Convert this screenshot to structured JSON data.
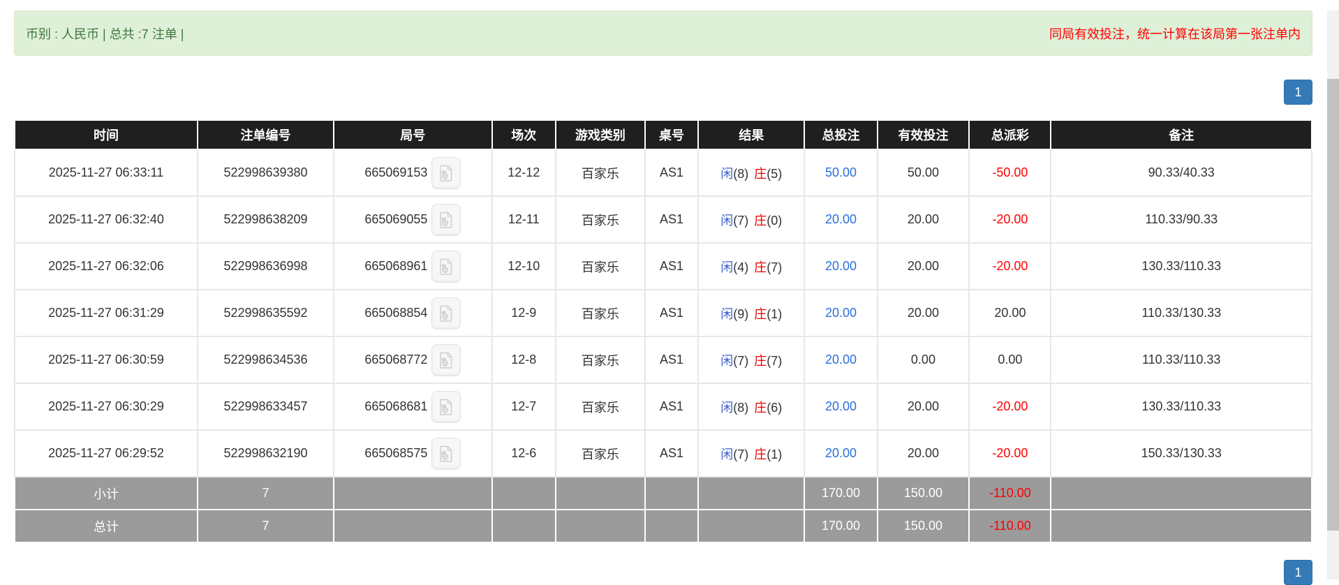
{
  "banner": {
    "left_text": "币别 : 人民币 | 总共 :7 注单 |",
    "right_text": "同局有效投注，统一计算在该局第一张注单内"
  },
  "pagination": {
    "page": "1"
  },
  "table": {
    "headers": {
      "time": "时间",
      "bet_no": "注单编号",
      "round_no": "局号",
      "session": "场次",
      "game_type": "游戏类别",
      "table_no": "桌号",
      "result": "结果",
      "total_bet": "总投注",
      "valid_bet": "有效投注",
      "payout": "总派彩",
      "remark": "备注"
    },
    "rows": [
      {
        "time": "2025-11-27 06:33:11",
        "bet_no": "522998639380",
        "round_no": "665069153",
        "session": "12-12",
        "game_type": "百家乐",
        "table_no": "AS1",
        "player_label": "闲",
        "player_score": "(8)",
        "banker_label": "庄",
        "banker_score": "(5)",
        "total_bet": "50.00",
        "valid_bet": "50.00",
        "payout": "-50.00",
        "remark": "90.33/40.33"
      },
      {
        "time": "2025-11-27 06:32:40",
        "bet_no": "522998638209",
        "round_no": "665069055",
        "session": "12-11",
        "game_type": "百家乐",
        "table_no": "AS1",
        "player_label": "闲",
        "player_score": "(7)",
        "banker_label": "庄",
        "banker_score": "(0)",
        "total_bet": "20.00",
        "valid_bet": "20.00",
        "payout": "-20.00",
        "remark": "110.33/90.33"
      },
      {
        "time": "2025-11-27 06:32:06",
        "bet_no": "522998636998",
        "round_no": "665068961",
        "session": "12-10",
        "game_type": "百家乐",
        "table_no": "AS1",
        "player_label": "闲",
        "player_score": "(4)",
        "banker_label": "庄",
        "banker_score": "(7)",
        "total_bet": "20.00",
        "valid_bet": "20.00",
        "payout": "-20.00",
        "remark": "130.33/110.33"
      },
      {
        "time": "2025-11-27 06:31:29",
        "bet_no": "522998635592",
        "round_no": "665068854",
        "session": "12-9",
        "game_type": "百家乐",
        "table_no": "AS1",
        "player_label": "闲",
        "player_score": "(9)",
        "banker_label": "庄",
        "banker_score": "(1)",
        "total_bet": "20.00",
        "valid_bet": "20.00",
        "payout": "20.00",
        "remark": "110.33/130.33"
      },
      {
        "time": "2025-11-27 06:30:59",
        "bet_no": "522998634536",
        "round_no": "665068772",
        "session": "12-8",
        "game_type": "百家乐",
        "table_no": "AS1",
        "player_label": "闲",
        "player_score": "(7)",
        "banker_label": "庄",
        "banker_score": "(7)",
        "total_bet": "20.00",
        "valid_bet": "0.00",
        "payout": "0.00",
        "remark": "110.33/110.33"
      },
      {
        "time": "2025-11-27 06:30:29",
        "bet_no": "522998633457",
        "round_no": "665068681",
        "session": "12-7",
        "game_type": "百家乐",
        "table_no": "AS1",
        "player_label": "闲",
        "player_score": "(8)",
        "banker_label": "庄",
        "banker_score": "(6)",
        "total_bet": "20.00",
        "valid_bet": "20.00",
        "payout": "-20.00",
        "remark": "130.33/110.33"
      },
      {
        "time": "2025-11-27 06:29:52",
        "bet_no": "522998632190",
        "round_no": "665068575",
        "session": "12-6",
        "game_type": "百家乐",
        "table_no": "AS1",
        "player_label": "闲",
        "player_score": "(7)",
        "banker_label": "庄",
        "banker_score": "(1)",
        "total_bet": "20.00",
        "valid_bet": "20.00",
        "payout": "-20.00",
        "remark": "150.33/130.33"
      }
    ],
    "subtotal": {
      "label": "小计",
      "count": "7",
      "total_bet": "170.00",
      "valid_bet": "150.00",
      "payout": "-110.00"
    },
    "total": {
      "label": "总计",
      "count": "7",
      "total_bet": "170.00",
      "valid_bet": "150.00",
      "payout": "-110.00"
    }
  },
  "icons": {
    "video": "film-icon"
  },
  "colors": {
    "banner_bg": "#dff0d8",
    "banner_text": "#3c763d",
    "alert_red": "#ff0000",
    "header_bg": "#1f1f1f",
    "summary_bg": "#9b9b9b",
    "accent_blue": "#337ab7",
    "link_blue": "#2a6edb",
    "player_blue": "#3a5fcd",
    "banker_red": "#e60000",
    "negative_red": "#ff0000"
  }
}
